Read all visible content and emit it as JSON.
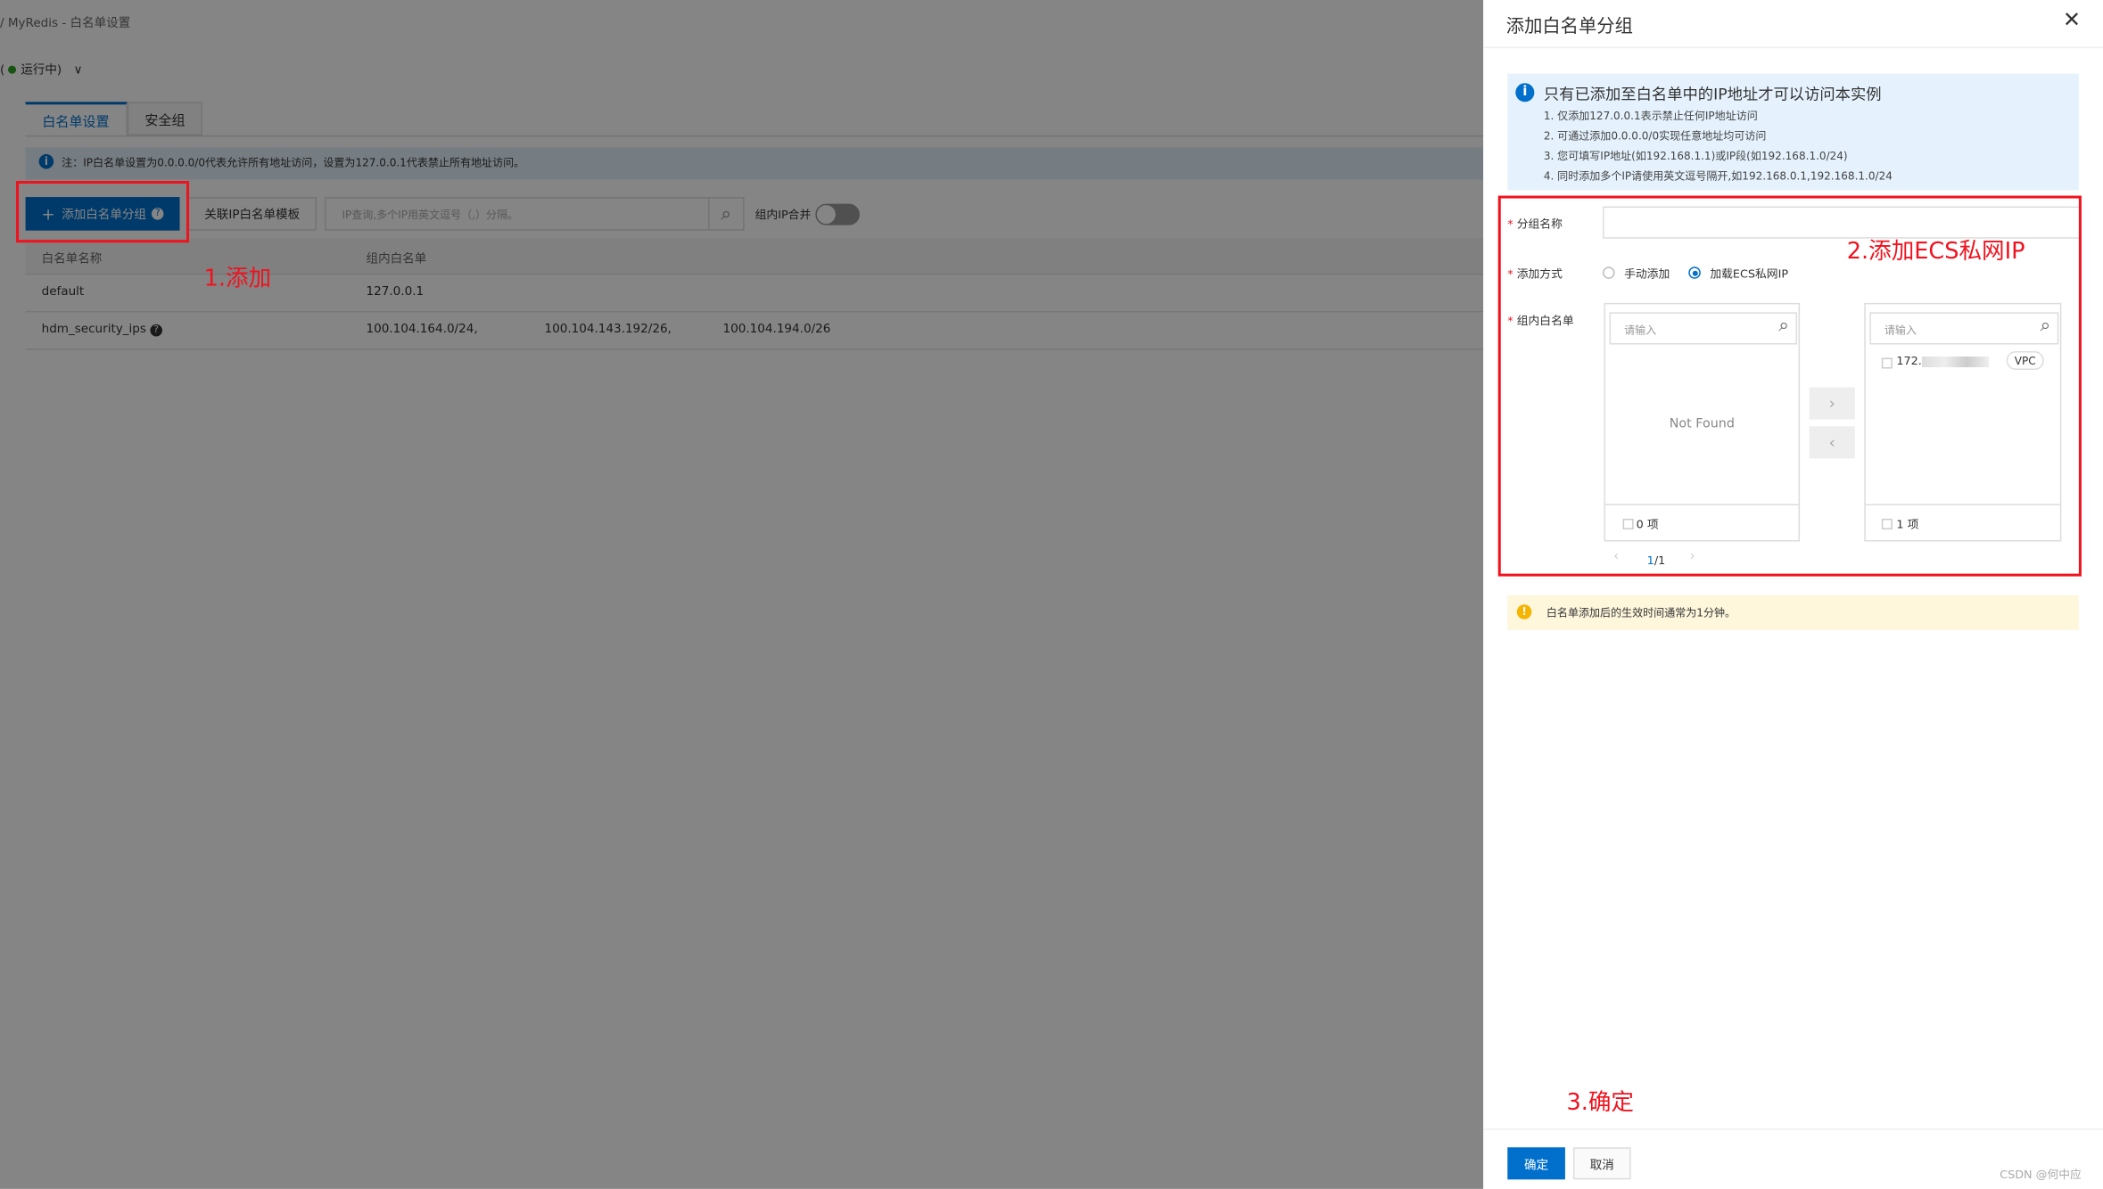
{
  "background": {
    "breadcrumb": "/  MyRedis - 白名单设置",
    "status": "运行中)",
    "status_prefix": "(",
    "status_color": "#2ea121",
    "tabs": [
      {
        "label": "白名单设置",
        "active": true
      },
      {
        "label": "安全组",
        "active": false
      }
    ],
    "notice": "注：IP白名单设置为0.0.0.0/0代表允许所有地址访问，设置为127.0.0.1代表禁止所有地址访问。",
    "add_button": "添加白名单分组",
    "template_button": "关联IP白名单模板",
    "search_placeholder": "IP查询,多个IP用英文逗号（,）分隔。",
    "merge_label": "组内IP合并",
    "merge_enabled": false,
    "table": {
      "headers": [
        "白名单名称",
        "组内白名单"
      ],
      "rows": [
        {
          "name": "default",
          "ips": [
            "127.0.0.1"
          ]
        },
        {
          "name": "hdm_security_ips",
          "ips": [
            "100.104.164.0/24,",
            "100.104.143.192/26,",
            "100.104.194.0/26"
          ]
        }
      ]
    },
    "annotation": "1.添加"
  },
  "drawer": {
    "title": "添加白名单分组",
    "info_title": "只有已添加至白名单中的IP地址才可以访问本实例",
    "info_items": [
      "1. 仅添加127.0.0.1表示禁止任何IP地址访问",
      "2. 可通过添加0.0.0.0/0实现任意地址均可访问",
      "3. 您可填写IP地址(如192.168.1.1)或IP段(如192.168.1.0/24)",
      "4. 同时添加多个IP请使用英文逗号隔开,如192.168.0.1,192.168.1.0/24"
    ],
    "group_name_label": "分组名称",
    "group_name_value": "",
    "method_label": "添加方式",
    "method_options": [
      {
        "label": "手动添加",
        "selected": false
      },
      {
        "label": "加载ECS私网IP",
        "selected": true
      }
    ],
    "whitelist_label": "组内白名单",
    "left_panel": {
      "placeholder": "请输入",
      "empty": "Not Found",
      "count": "0 项"
    },
    "right_panel": {
      "placeholder": "请输入",
      "items": [
        {
          "ip": "172.",
          "tag": "VPC"
        }
      ],
      "count": "1 项"
    },
    "pagination": {
      "current": "1",
      "total": "/1"
    },
    "warning": "白名单添加后的生效时间通常为1分钟。",
    "annotation_2": "2.添加ECS私网IP",
    "annotation_3": "3.确定",
    "ok": "确定",
    "cancel": "取消",
    "accent": "#0070cc"
  },
  "watermark": "CSDN @何中应"
}
